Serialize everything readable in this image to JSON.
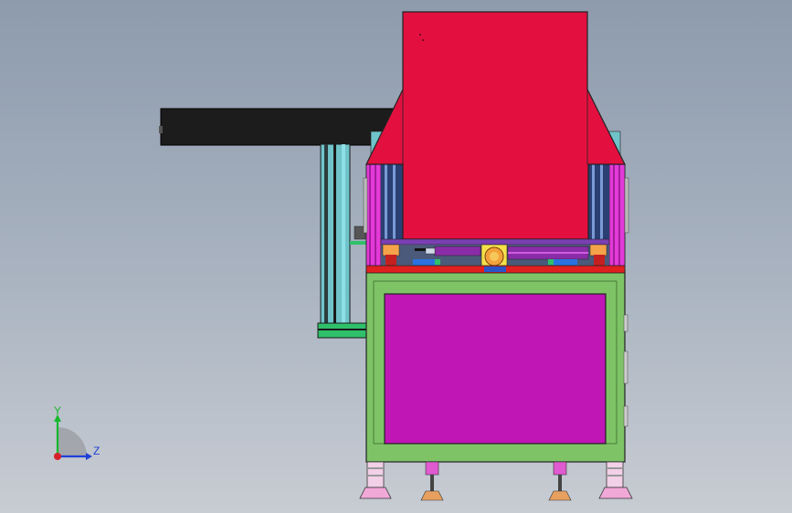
{
  "viewport": {
    "background_top": "#8d9bad",
    "background_bottom": "#c8ccd3"
  },
  "triad": {
    "y_label": "Y",
    "z_label": "Z",
    "y_color": "#16b82c",
    "z_color": "#1f3fd6",
    "x_color": "#d6202a"
  },
  "model": {
    "hopper_color": "#e3103f",
    "arm_color": "#1c1c1c",
    "base_frame_color": "#7ec467",
    "panel_color": "#bf16b5",
    "rail_color": "#e01f1f",
    "side_plate_color": "#e33ad8",
    "column_color": "#6fc3c9",
    "foot_pad_color": "#f2a8d8",
    "leveling_foot_color": "#e8a060"
  }
}
